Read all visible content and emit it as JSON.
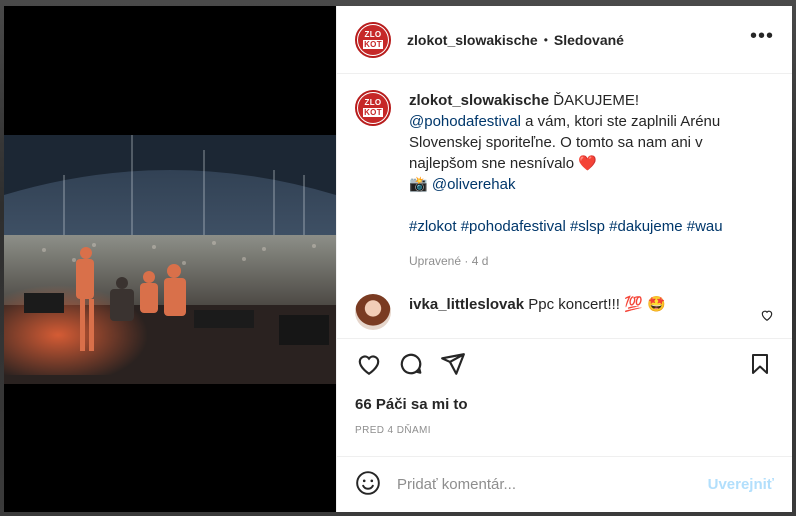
{
  "post": {
    "username": "zlokot_slowakische",
    "separator": "•",
    "follow_status": "Sledované",
    "more_glyph": "•••",
    "avatar_logo_top": "ZLO",
    "avatar_logo_bottom": "KOT",
    "caption": {
      "username": "zlokot_slowakische",
      "lead": "ĎAKUJEME!",
      "mention1": "@pohodafestival",
      "text1": " a vám, ktori ste zaplnili Arénu Slovenskej sporiteľne. O tomto sa nam ani v najlepšom sne nesnívalo ",
      "heart": "❤️",
      "camera": "📸",
      "mention2": "@oliverehak",
      "hashtags": [
        "#zlokot",
        "#pohodafestival",
        "#slsp",
        "#dakujeme",
        "#wau"
      ],
      "meta": "Upravené · 4 d"
    },
    "comments": [
      {
        "username": "ivka_littleslovak",
        "text": "Ppc koncert!!! 💯 🤩"
      }
    ],
    "likes": "66 Páči sa mi to",
    "time_ago": "PRED 4 DŇAMI",
    "add_comment": {
      "placeholder": "Pridať komentár...",
      "post_label": "Uverejniť",
      "emoji_icon": "smiley-icon"
    },
    "icons": [
      "heart-icon",
      "comment-icon",
      "share-icon",
      "bookmark-icon",
      "more-icon"
    ],
    "colors": {
      "link": "#00376b",
      "post_disabled": "#b2dffc",
      "muted": "#8e8e8e"
    }
  }
}
